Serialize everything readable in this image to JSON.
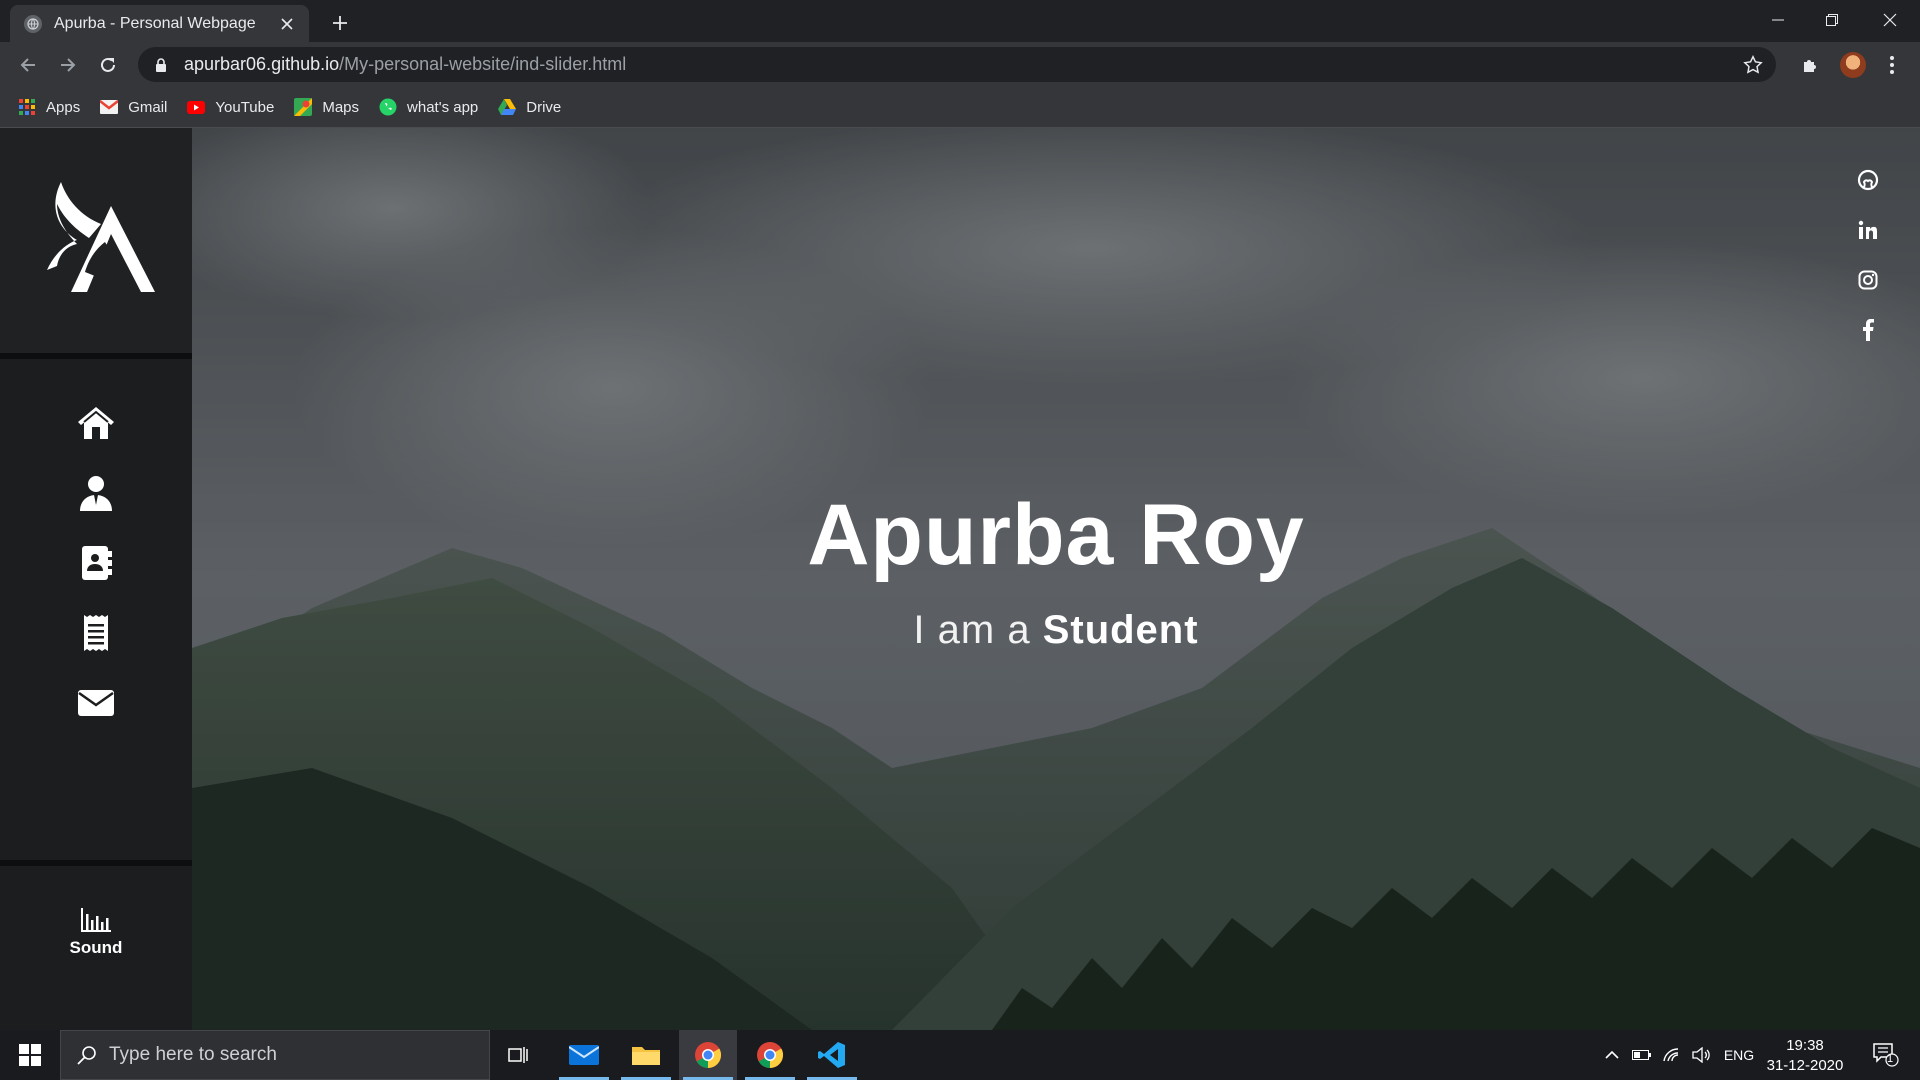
{
  "browser": {
    "tab_title": "Apurba - Personal Webpage",
    "url_host": "apurbar06.github.io",
    "url_path": "/My-personal-website/ind-slider.html"
  },
  "bookmarks": [
    {
      "label": "Apps",
      "icon": "apps-grid-icon"
    },
    {
      "label": "Gmail",
      "icon": "gmail-icon"
    },
    {
      "label": "YouTube",
      "icon": "youtube-icon"
    },
    {
      "label": "Maps",
      "icon": "maps-icon"
    },
    {
      "label": "what's app",
      "icon": "whatsapp-icon"
    },
    {
      "label": "Drive",
      "icon": "drive-icon"
    }
  ],
  "sidebar": {
    "nav": [
      {
        "icon": "home-icon"
      },
      {
        "icon": "user-icon"
      },
      {
        "icon": "contact-card-icon"
      },
      {
        "icon": "document-icon"
      },
      {
        "icon": "mail-icon"
      }
    ],
    "sound_label": "Sound"
  },
  "hero": {
    "name": "Apurba Roy",
    "subtitle_prefix": "I am a ",
    "subtitle_role": "Student"
  },
  "social": [
    {
      "icon": "github-icon"
    },
    {
      "icon": "linkedin-icon"
    },
    {
      "icon": "instagram-icon"
    },
    {
      "icon": "facebook-icon"
    }
  ],
  "taskbar": {
    "search_placeholder": "Type here to search",
    "language": "ENG",
    "time": "19:38",
    "date": "31-12-2020",
    "notification_count": "1"
  },
  "colors": {
    "sidebar_bg": "#1b1d1f",
    "accent_blue": "#76b9ed",
    "chrome_bg": "#35363a"
  }
}
